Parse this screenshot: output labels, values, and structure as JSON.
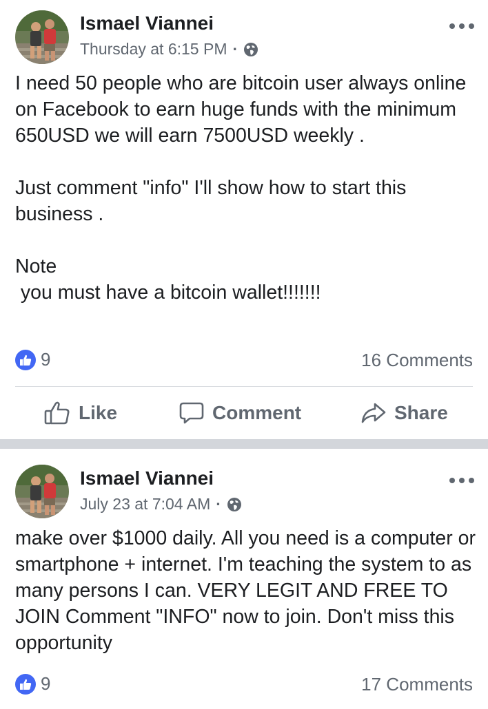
{
  "posts": [
    {
      "author": "Ismael Viannei",
      "timestamp": "Thursday at 6:15 PM",
      "privacy_icon": "globe-icon",
      "text": "I need 50 people who are bitcoin user always online on Facebook to earn huge funds with the minimum 650USD we will earn 7500USD weekly .\n\nJust comment \"info\" I'll show how to start this business .\n\nNote\n you must have a bitcoin wallet!!!!!!!",
      "reaction_count": "9",
      "comments_count": "16 Comments",
      "actions": {
        "like": "Like",
        "comment": "Comment",
        "share": "Share"
      }
    },
    {
      "author": "Ismael Viannei",
      "timestamp": "July 23 at 7:04 AM",
      "privacy_icon": "globe-icon",
      "text": "make over $1000 daily. All you need is a computer or smartphone + internet. I'm teaching the system to as many persons I can. VERY LEGIT AND FREE TO JOIN Comment \"INFO\" now to join. Don't miss this opportunity",
      "reaction_count": "9",
      "comments_count": "17 Comments"
    }
  ],
  "colors": {
    "text": "#1c1e21",
    "secondary": "#606770",
    "like_blue": "#4267f4",
    "separator": "#d3d6db"
  }
}
